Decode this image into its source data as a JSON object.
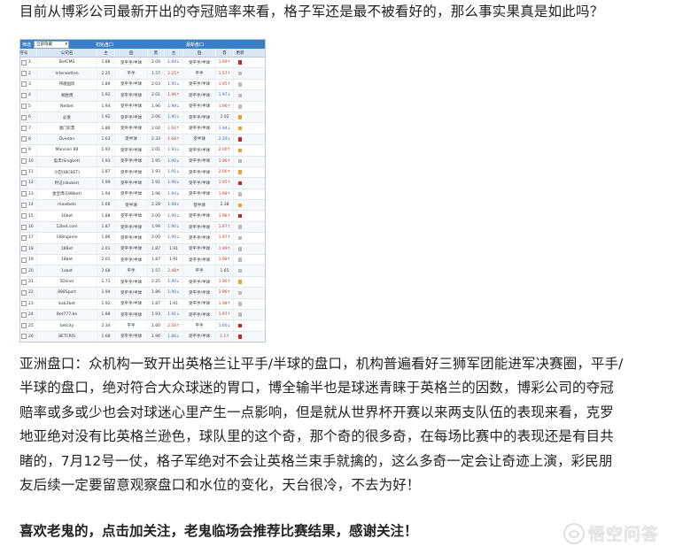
{
  "article": {
    "intro": "目前从博彩公司最新开出的夺冠赔率来看，格子军还是最不被看好的，那么事实果真是如此吗？",
    "paragraph_lines": [
      "亚洲盘口：众机构一致开出英格兰让平手/半球的盘口，机构普遍看好三狮军团能进军决赛圈，平手/",
      "半球的盘口，绝对符合大众球迷的胃口，博全输半也是球迷青睐于英格兰的因数，博彩公司的夺冠",
      "赔率或多或少也会对球迷心里产生一点影响，但是就从世界杯开赛以来两支队伍的表现来看，克罗",
      "地亚绝对没有比英格兰逊色，球队里的这个奇，那个奇的很多奇，在每场比赛中的表现还是有目共",
      "睹的，7月12号一仗，格子军绝对不会让英格兰束手就擒的，这么多奇一定会让奇迹上演，彩民朋",
      "友后续一定要留意观察盘口和水位的变化，天台很冷，不去为好！"
    ],
    "closing": "喜欢老鬼的，点击加关注，老鬼临场会推荐比赛结果，感谢关注！",
    "watermark": "悟空问答"
  },
  "screenshot": {
    "toolbar": {
      "filter_label": "筛选",
      "dropdown": "全部隐藏",
      "initial": "初始盘口",
      "latest": "最新盘口"
    },
    "headers": [
      "序号",
      "",
      "公司名",
      "主",
      "盘",
      "客",
      "主",
      "盘",
      "客",
      "更新"
    ],
    "rows": [
      [
        "1",
        "BetCMS",
        "1.88",
        "受平手/半球",
        "2.04",
        "1.94↓",
        "受平手/半球",
        "1.99↑"
      ],
      [
        "2",
        "Interwetten",
        "2.25",
        "平手",
        "1.57",
        "2.25↑",
        "平手",
        "1.57↑"
      ],
      [
        "3",
        "伟德国际",
        "1.89",
        "受平手/半球",
        "2.03",
        "1.95↓",
        "受平手/半球",
        "1.95↑"
      ],
      [
        "4",
        "易胜博",
        "1.92",
        "受平手/半球",
        "2.01",
        "1.96↑",
        "受平手/半球",
        "1.97↓"
      ],
      [
        "5",
        "Nelbet",
        "1.94",
        "受平手/半球",
        "1.96",
        "1.98↓",
        "受平手/半球",
        "1.96↑"
      ],
      [
        "6",
        "必发",
        "1.92",
        "受平手/半球",
        "2.06",
        "1.95↓",
        "受平手/半球",
        "2.02"
      ],
      [
        "7",
        "澳门彩票",
        "1.86",
        "受平手/半球",
        "2.00",
        "1.92↑",
        "受平手/半球",
        "1.94↓"
      ],
      [
        "8",
        "Dvedan",
        "1.63",
        "受半球",
        "2.33",
        "1.68↑",
        "受半球",
        "2.29↓"
      ],
      [
        "9",
        "Mansion 88",
        "1.92",
        "受平手/半球",
        "2.01",
        "1.93↓",
        "受平手/半球",
        "2.00↑"
      ],
      [
        "10",
        "盈丰(Singbet)",
        "1.93",
        "受平手/半球",
        "1.95",
        "1.90↓",
        "受平手/半球",
        "1.96↑"
      ],
      [
        "11",
        "沙巴(IBCBET)",
        "1.87",
        "受平手/半球",
        "1.93",
        "1.91↓",
        "受平手/半球",
        "2.00↑"
      ],
      [
        "12",
        "利记(sbobet)",
        "1.99",
        "受平手/半球",
        "1.91",
        "1.96↓",
        "受平手/半球",
        "1.95↑"
      ],
      [
        "13",
        "金宝博(188bet)",
        "1.94",
        "受平手/半球",
        "1.96",
        "1.94↓",
        "受平手/半球",
        "1.98↑"
      ],
      [
        "14",
        "maxibets",
        "1.66",
        "受半球",
        "2.28",
        "1.68↓",
        "受半球",
        "2.38"
      ],
      [
        "15",
        "10bet",
        "1.88",
        "受平手/半球",
        "2.00",
        "1.90↓",
        "受平手/半球",
        "1.98↑"
      ],
      [
        "16",
        "12bet.com",
        "1.87",
        "受平手/半球",
        "1.99",
        "1.90↓",
        "受平手/半球",
        "1.97↑"
      ],
      [
        "17",
        "188ngame",
        "1.86",
        "受平手/半球",
        "2.00",
        "1.90↓",
        "受平手/半球",
        "1.97↑"
      ],
      [
        "18",
        "18Bet",
        "2.01",
        "受平手/半球",
        "1.87",
        "1.91",
        "受平手/半球",
        "1.99↑"
      ],
      [
        "19",
        "18bet",
        "2.01",
        "受平手/半球",
        "1.87",
        "1.91",
        "受平手/半球",
        "1.98↑"
      ],
      [
        "20",
        "1xbet",
        "2.68",
        "平手",
        "1.57",
        "2.48↑",
        "平手",
        "1.65"
      ],
      [
        "21",
        "5Dsner",
        "1.71",
        "受平手/半球",
        "2.25",
        "1.90↓",
        "受平手/半球",
        "1.96↑"
      ],
      [
        "22",
        "888Sport",
        "1.94",
        "受平手/半球",
        "1.86",
        "1.90↓",
        "受平手/半球",
        "1.96↑"
      ],
      [
        "23",
        "bab3bet",
        "1.92",
        "受平手/半球",
        "1.87",
        "1.91",
        "受平手/半球",
        "1.98↑"
      ],
      [
        "24",
        "Bet777.be",
        "1.88",
        "受平手/半球",
        "1.93",
        "1.91↓",
        "受平手/半球",
        "1.97↑"
      ],
      [
        "25",
        "betcity",
        "2.34",
        "平手",
        "1.60",
        "2.58↑",
        "平手",
        "1.60↓"
      ],
      [
        "26",
        "BETCRIS",
        "1.68",
        "受平手/半球",
        "1.96",
        "1.86↓",
        "受平手/半球",
        "1.1↑"
      ]
    ],
    "flag_colors": [
      "#cc2222",
      "#bbbbbb",
      "#bbbbbb",
      "#bbbbbb",
      "#bbbbbb",
      "#f0a030",
      "#f0a030",
      "#cc2222",
      "#f0a030",
      "#bbbbbb",
      "#f0a030",
      "#cc2222",
      "#bbbbbb",
      "#f0a030",
      "#cc2222",
      "#bbbbbb",
      "#bbbbbb",
      "#bbbbbb",
      "#bbbbbb",
      "#bbbbbb",
      "#f0a030",
      "#bbbbbb",
      "#bbbbbb",
      "#bbbbbb",
      "#cc2222",
      "#cc2222"
    ]
  }
}
